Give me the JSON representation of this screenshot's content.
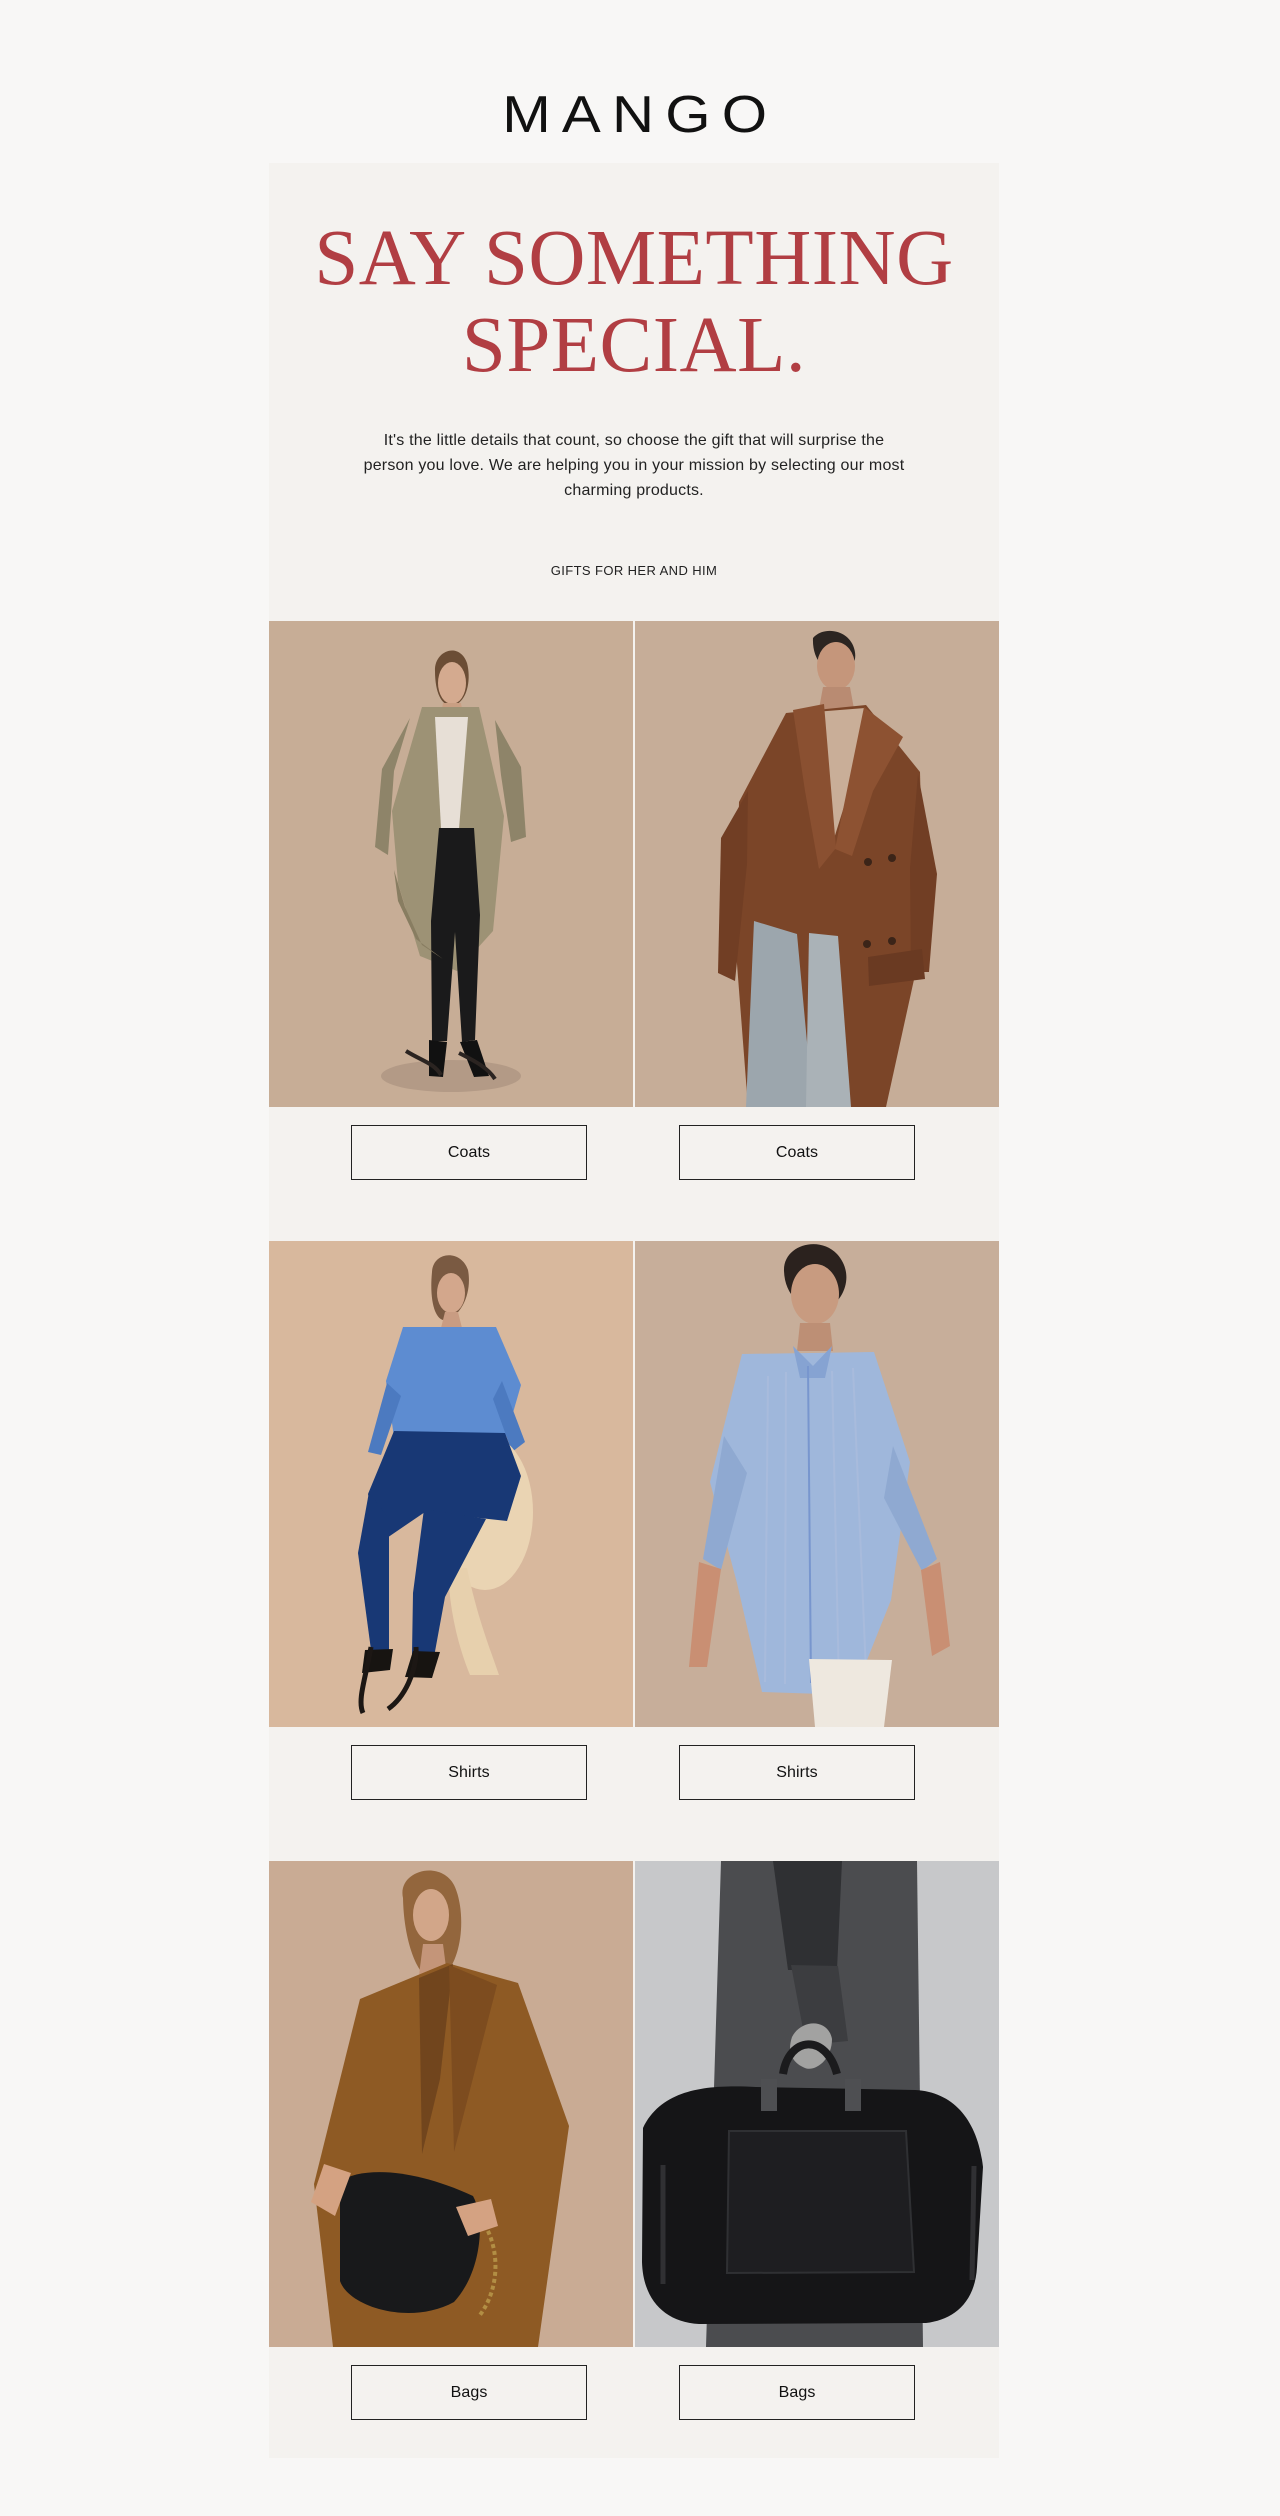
{
  "preheader": "",
  "brand": {
    "logo_text": "MANGO"
  },
  "hero": {
    "headline_line_1": "SAY SOMETHING",
    "headline_line_2": "SPECIAL.",
    "intro": "It's the little details that count, so choose the gift that will surprise the person you love. We are helping you in your mission by selecting our most charming products.",
    "gifts_link": "GIFTS FOR HER AND HIM"
  },
  "products": [
    {
      "button": "Coats"
    },
    {
      "button": "Coats"
    },
    {
      "button": "Shirts"
    },
    {
      "button": "Shirts"
    },
    {
      "button": "Bags"
    },
    {
      "button": "Bags"
    }
  ],
  "colors": {
    "headline": "#b13e43",
    "page_background": "#f8f7f6",
    "email_background": "#f4f2ef",
    "button_border": "#222222"
  }
}
